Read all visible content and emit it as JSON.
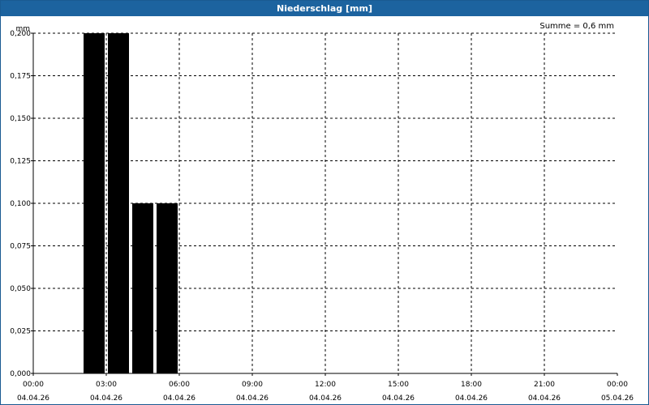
{
  "window": {
    "title": "Niederschlag [mm]"
  },
  "summary": "Summe = 0,6 mm",
  "chart_data": {
    "type": "bar",
    "title": "Niederschlag [mm]",
    "xlabel": "",
    "ylabel": "mm",
    "ylim": [
      0,
      0.2
    ],
    "xlim": [
      "04.04.26 00:00",
      "05.04.26 00:00"
    ],
    "yticks": [
      0,
      0.025,
      0.05,
      0.075,
      0.1,
      0.125,
      0.15,
      0.175,
      0.2
    ],
    "ytick_labels": [
      "0,000",
      "0,025",
      "0,050",
      "0,075",
      "0,100",
      "0,125",
      "0,150",
      "0,175",
      "0,200"
    ],
    "xtick_labels": [
      {
        "time": "00:00",
        "date": "04.04.26"
      },
      {
        "time": "03:00",
        "date": "04.04.26"
      },
      {
        "time": "06:00",
        "date": "04.04.26"
      },
      {
        "time": "09:00",
        "date": "04.04.26"
      },
      {
        "time": "12:00",
        "date": "04.04.26"
      },
      {
        "time": "15:00",
        "date": "04.04.26"
      },
      {
        "time": "18:00",
        "date": "04.04.26"
      },
      {
        "time": "21:00",
        "date": "04.04.26"
      },
      {
        "time": "00:00",
        "date": "05.04.26"
      }
    ],
    "bars": [
      {
        "start": "04.04.26 02:00",
        "end": "04.04.26 03:00",
        "value": 0.2
      },
      {
        "start": "04.04.26 03:00",
        "end": "04.04.26 04:00",
        "value": 0.2
      },
      {
        "start": "04.04.26 04:00",
        "end": "04.04.26 05:00",
        "value": 0.1
      },
      {
        "start": "04.04.26 05:00",
        "end": "04.04.26 06:00",
        "value": 0.1
      }
    ],
    "grid": true,
    "bar_color": "#000000",
    "grid_color": "#000000",
    "header_color": "#1c639f"
  }
}
